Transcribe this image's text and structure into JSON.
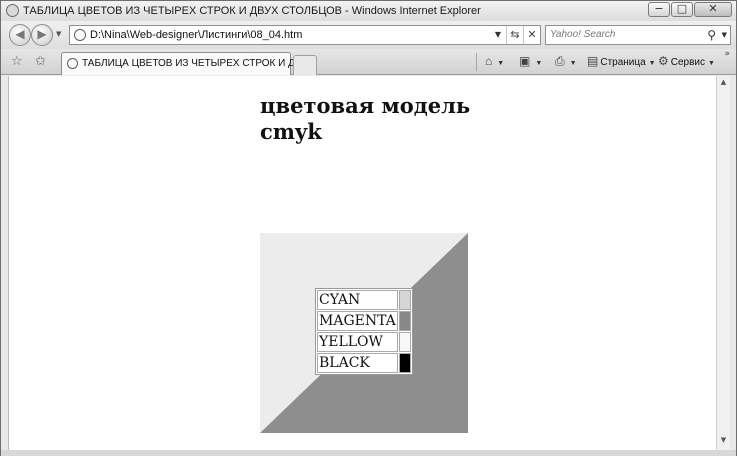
{
  "window": {
    "title": "ТАБЛИЦА ЦВЕТОВ ИЗ ЧЕТЫРЕХ СТРОК И ДВУХ СТОЛБЦОВ - Windows Internet Explorer",
    "minimize_glyph": "−",
    "maximize_glyph": "□",
    "close_glyph": "✕"
  },
  "address_bar": {
    "url": "D:\\Nina\\Web-designer\\Листинги\\08_04.htm",
    "search_placeholder": "Yahoo! Search"
  },
  "tabs": [
    {
      "label": "ТАБЛИЦА ЦВЕТОВ ИЗ ЧЕТЫРЕХ СТРОК И ДВУ..."
    }
  ],
  "commands": {
    "page_label": "Страница",
    "tools_label": "Сервис"
  },
  "page": {
    "heading_line1": "цветовая модель",
    "heading_line2": "cmyk",
    "figure": {
      "top_left_color": "#ececec",
      "bottom_right_color": "#8e8e8e"
    },
    "color_table": [
      {
        "name": "CYAN",
        "swatch": "#d6d6d6"
      },
      {
        "name": "MAGENTA",
        "swatch": "#878787"
      },
      {
        "name": "YELLOW",
        "swatch": "#f8f8f8"
      },
      {
        "name": "BLACK",
        "swatch": "#000000"
      }
    ]
  }
}
